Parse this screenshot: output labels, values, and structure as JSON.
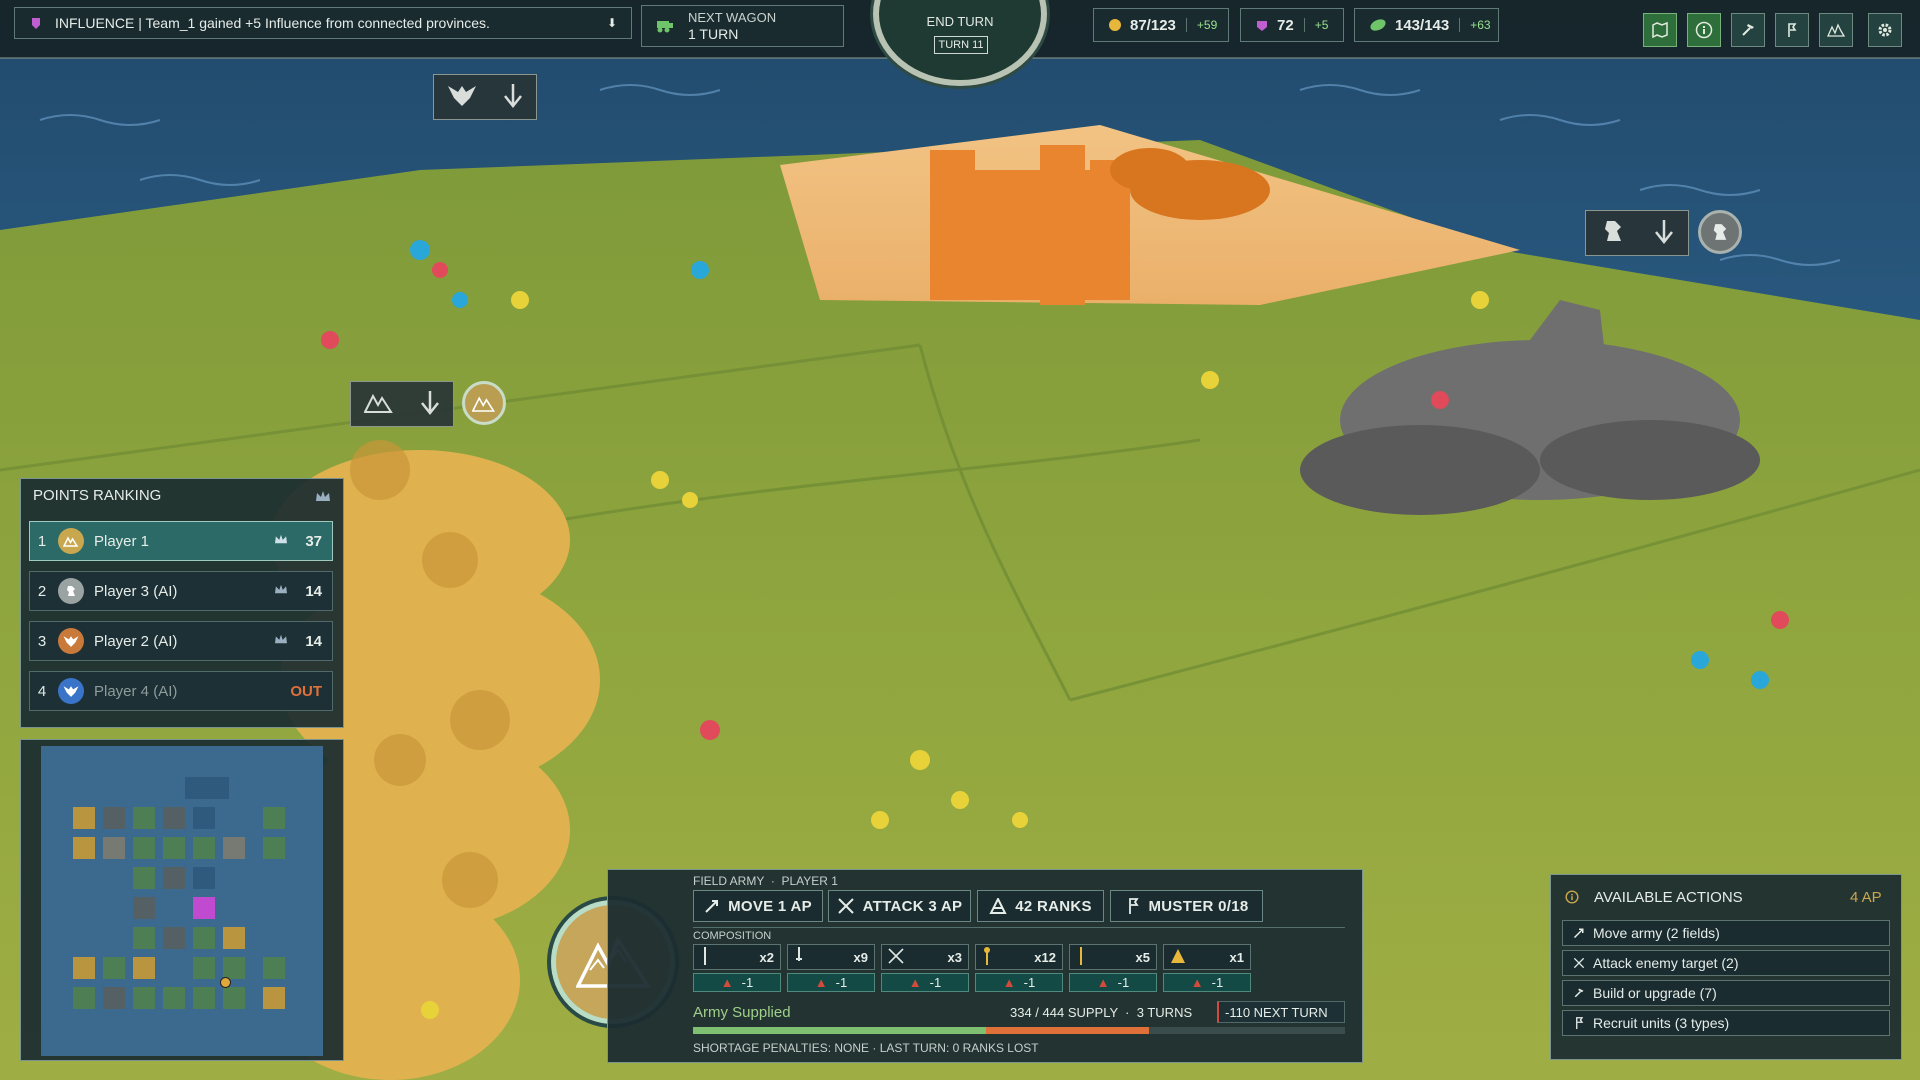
{
  "notification": {
    "text": "INFLUENCE | Team_1 gained +5 Influence from connected provinces."
  },
  "wagon": {
    "title": "NEXT WAGON",
    "value": "1 TURN"
  },
  "end_turn": {
    "label": "END TURN",
    "turn": "TURN 11"
  },
  "resources": [
    {
      "icon": "gold-coin-icon",
      "value": "87/123",
      "gain": "+59"
    },
    {
      "icon": "influence-icon",
      "value": "72",
      "gain": "+5"
    },
    {
      "icon": "food-icon",
      "value": "143/143",
      "gain": "+63"
    }
  ],
  "top_icons": [
    "map-icon",
    "info-icon",
    "hammer-icon",
    "recruit-icon",
    "army-icon",
    "gear-icon"
  ],
  "ranking": {
    "title": "POINTS RANKING",
    "players": [
      {
        "rank": "1",
        "name": "Player 1",
        "points": "37",
        "color": "#c9a74e"
      },
      {
        "rank": "2",
        "name": "Player 3 (AI)",
        "points": "14",
        "color": "#9aa3a2"
      },
      {
        "rank": "3",
        "name": "Player 2 (AI)",
        "points": "14",
        "color": "#c97a3a"
      },
      {
        "rank": "4",
        "name": "Player 4 (AI)",
        "points": "OUT",
        "color": "#3a74c9"
      }
    ]
  },
  "army": {
    "type": "FIELD ARMY",
    "owner": "PLAYER 1",
    "actions": {
      "move": "MOVE 1 AP",
      "attack": "ATTACK 3 AP",
      "ranks": "42 RANKS",
      "muster": "MUSTER 0/18"
    },
    "composition_label": "COMPOSITION",
    "units": [
      {
        "icon": "spearman-icon",
        "count": "x2",
        "change": "-1"
      },
      {
        "icon": "swordsman-icon",
        "count": "x9",
        "change": "-1"
      },
      {
        "icon": "crossed-swords-icon",
        "count": "x3",
        "change": "-1"
      },
      {
        "icon": "torch-icon",
        "count": "x12",
        "change": "-1"
      },
      {
        "icon": "banner-icon",
        "count": "x5",
        "change": "-1"
      },
      {
        "icon": "camp-icon",
        "count": "x1",
        "change": "-1"
      }
    ],
    "supply_status": "Army Supplied",
    "supply": "334 / 444 SUPPLY",
    "turns": "3 TURNS",
    "next_turn": "-110  NEXT TURN",
    "supply_fraction": 0.75,
    "upkeep_fraction": 0.25,
    "footer": "SHORTAGE PENALTIES: NONE  ·  LAST TURN: 0 RANKS LOST"
  },
  "available": {
    "title": "AVAILABLE ACTIONS",
    "ap": "4 AP",
    "items": [
      {
        "icon": "move-icon",
        "label": "Move army (2 fields)"
      },
      {
        "icon": "attack-icon",
        "label": "Attack enemy target (2)"
      },
      {
        "icon": "hammer-icon",
        "label": "Build or upgrade (7)"
      },
      {
        "icon": "recruit-icon",
        "label": "Recruit units (3 types)"
      }
    ]
  },
  "colors": {
    "accent": "#c9a74e",
    "out": "#e0703a",
    "supplied": "#9fd089",
    "panel": "#1b2c30"
  }
}
